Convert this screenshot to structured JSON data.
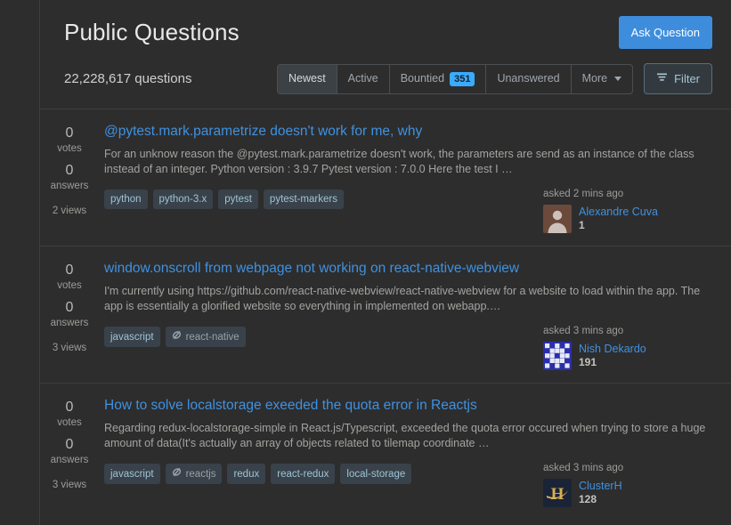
{
  "header": {
    "title": "Public Questions",
    "ask_button": "Ask Question"
  },
  "subheader": {
    "question_count": "22,228,617 questions",
    "tabs": [
      {
        "label": "Newest",
        "active": true,
        "badge": null,
        "caret": false
      },
      {
        "label": "Active",
        "active": false,
        "badge": null,
        "caret": false
      },
      {
        "label": "Bountied",
        "active": false,
        "badge": "351",
        "caret": false
      },
      {
        "label": "Unanswered",
        "active": false,
        "badge": null,
        "caret": false
      },
      {
        "label": "More",
        "active": false,
        "badge": null,
        "caret": true
      }
    ],
    "filter_button": "Filter"
  },
  "questions": [
    {
      "votes": "0",
      "votes_label": "votes",
      "answers": "0",
      "answers_label": "answers",
      "views": "2 views",
      "title": "@pytest.mark.parametrize doesn't work for me, why",
      "excerpt": "For an unknow reason the @pytest.mark.parametrize doesn't work, the parameters are send as an instance of the class instead of an integer. Python version : 3.9.7 Pytest version : 7.0.0 Here the test I …",
      "tags": [
        {
          "name": "python",
          "ignored": false
        },
        {
          "name": "python-3.x",
          "ignored": false
        },
        {
          "name": "pytest",
          "ignored": false
        },
        {
          "name": "pytest-markers",
          "ignored": false
        }
      ],
      "asked": "asked 2 mins ago",
      "user": "Alexandre Cuva",
      "reputation": "1",
      "avatar_type": "person-silhouette",
      "avatar_bg": "#6b4a3c"
    },
    {
      "votes": "0",
      "votes_label": "votes",
      "answers": "0",
      "answers_label": "answers",
      "views": "3 views",
      "title": "window.onscroll from webpage not working on react-native-webview",
      "excerpt": "I'm currently using https://github.com/react-native-webview/react-native-webview for a website to load within the app. The app is essentially a glorified website so everything in implemented on webapp.…",
      "tags": [
        {
          "name": "javascript",
          "ignored": false
        },
        {
          "name": "react-native",
          "ignored": true
        }
      ],
      "asked": "asked 3 mins ago",
      "user": "Nish Dekardo",
      "reputation": "191",
      "avatar_type": "identicon",
      "avatar_bg": "#2b2ea8"
    },
    {
      "votes": "0",
      "votes_label": "votes",
      "answers": "0",
      "answers_label": "answers",
      "views": "3 views",
      "title": "How to solve localstorage exeeded the quota error in Reactjs",
      "excerpt": "Regarding redux-localstorage-simple in React.js/Typescript, exceeded the quota error occured when trying to store a huge amount of data(It's actually an array of objects related to tilemap coordinate …",
      "tags": [
        {
          "name": "javascript",
          "ignored": false
        },
        {
          "name": "reactjs",
          "ignored": true
        },
        {
          "name": "redux",
          "ignored": false
        },
        {
          "name": "react-redux",
          "ignored": false
        },
        {
          "name": "local-storage",
          "ignored": false
        }
      ],
      "asked": "asked 3 mins ago",
      "user": "ClusterH",
      "reputation": "128",
      "avatar_type": "letter-h-logo",
      "avatar_bg": "#1b2436"
    }
  ],
  "colors": {
    "page_bg": "#2d2d2d",
    "accent_blue": "#3e8ddd",
    "link_blue": "#3f91e0",
    "badge_blue": "#39acff",
    "tag_bg": "#39424a",
    "tag_text": "#9fc3d6",
    "divider": "#3d3d3d"
  }
}
